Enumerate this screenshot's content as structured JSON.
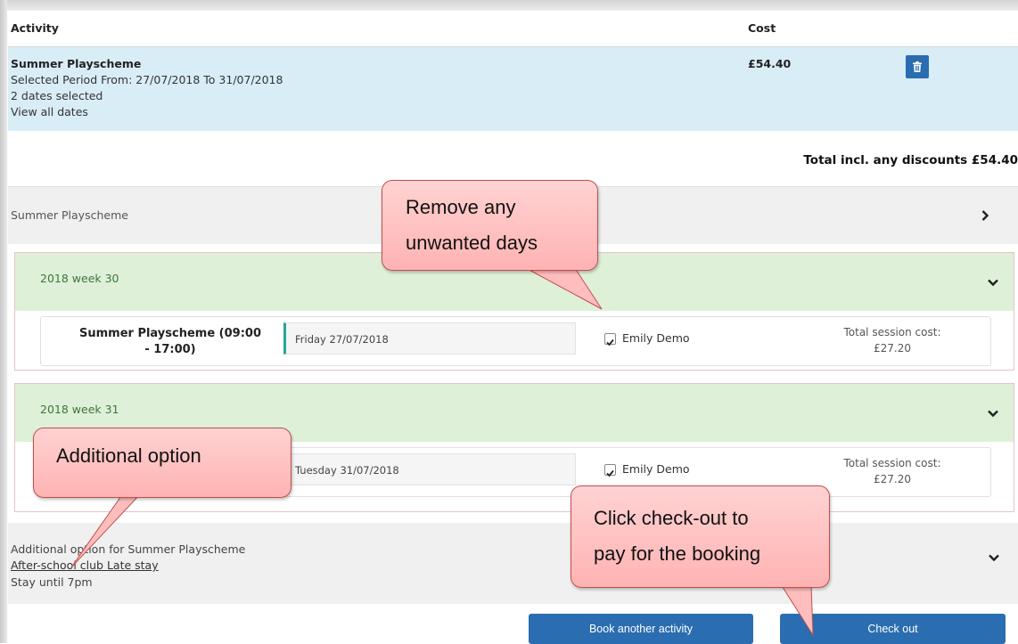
{
  "header": {
    "activity_label": "Activity",
    "cost_label": "Cost"
  },
  "booking_item": {
    "name": "Summer Playscheme",
    "period": "Selected Period From: 27/07/2018 To 31/07/2018",
    "dates_selected": "2 dates selected",
    "view_all_dates": "View all dates",
    "cost": "£54.40",
    "delete_icon": "trash-icon"
  },
  "total": "Total incl. any discounts £54.40",
  "activity_panel": {
    "title": "Summer Playscheme",
    "icon": "chevron-right-icon"
  },
  "weeks": [
    {
      "label": "2018 week 30",
      "session": {
        "name": "Summer Playscheme (09:00 - 17:00)",
        "date": "Friday 27/07/2018",
        "child": "Emily Demo",
        "cost_label": "Total session cost:",
        "cost": "£27.20"
      }
    },
    {
      "label": "2018 week 31",
      "session": {
        "name": "",
        "date": "Tuesday 31/07/2018",
        "child": "Emily Demo",
        "cost_label": "Total session cost:",
        "cost": "£27.20"
      }
    }
  ],
  "additional_option": {
    "heading": "Additional option for Summer Playscheme",
    "link": "After-school club Late stay",
    "description": "Stay until 7pm"
  },
  "buttons": {
    "book_another": "Book another activity",
    "check_out": "Check out"
  },
  "callouts": {
    "remove_days": [
      "Remove any",
      "unwanted days"
    ],
    "additional_option": "Additional option",
    "check_out": [
      "Click check-out to",
      "pay for the booking"
    ]
  },
  "colors": {
    "button_blue": "#2a6db0",
    "item_highlight": "#d9edf7",
    "week_green": "#dff0d8",
    "callout_fill": "#ffb3b3"
  }
}
